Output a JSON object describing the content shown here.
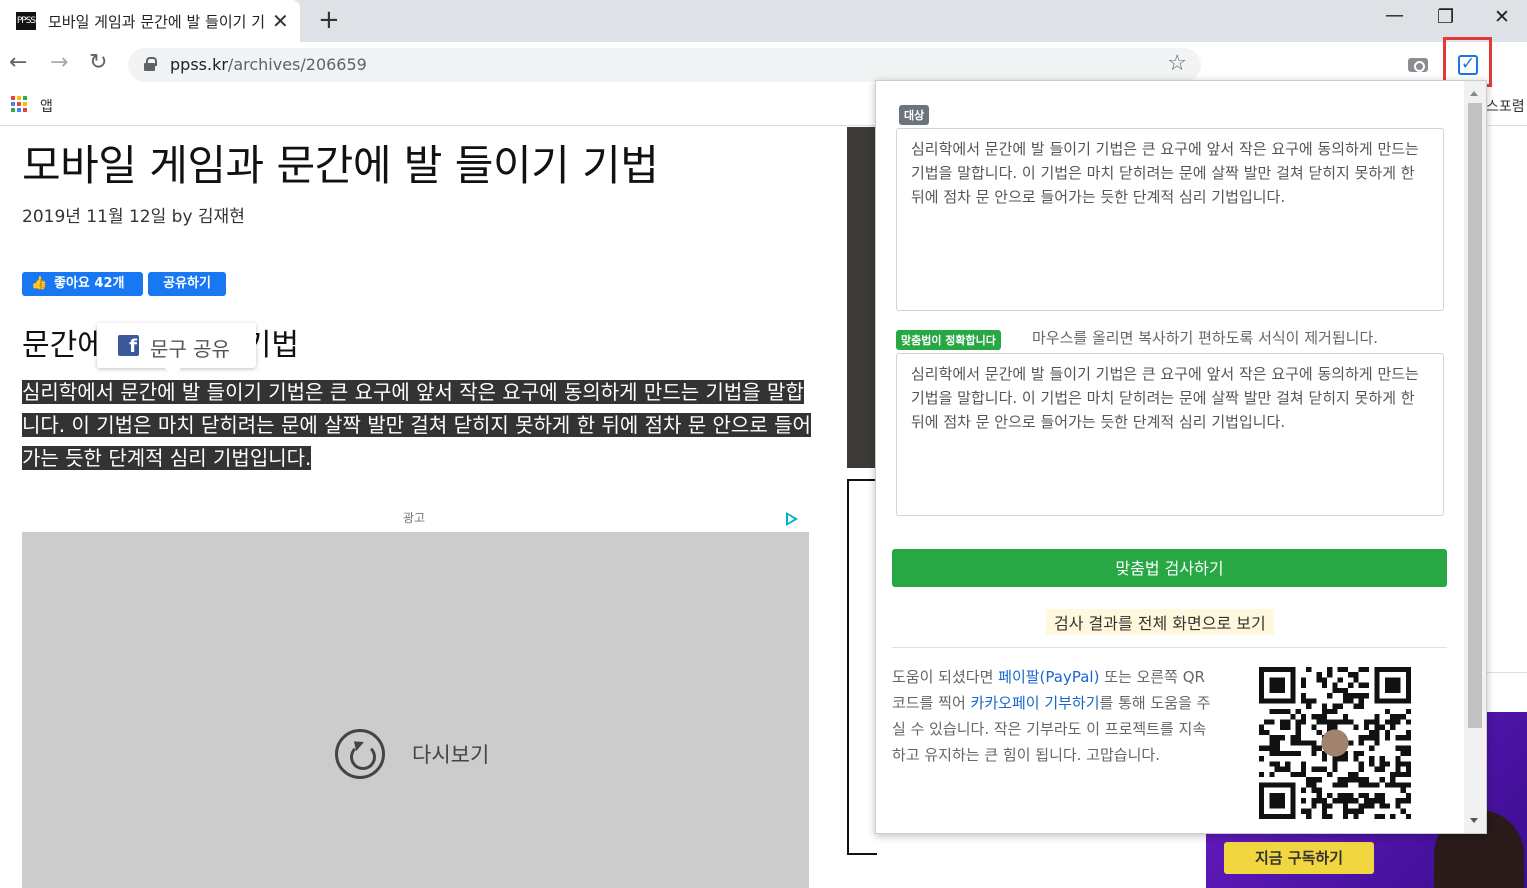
{
  "browser": {
    "tab_title": "모바일 게임과 문간에 발 들이기 기법",
    "tab_favicon": "PPSS",
    "url_host": "ppss.kr",
    "url_path": "/archives/206659",
    "bookmarks": {
      "apps_label": "앱",
      "right_item": "스포렴"
    },
    "icons": {
      "back": "back-arrow-icon",
      "forward": "forward-arrow-icon",
      "reload": "reload-icon",
      "star": "star-icon",
      "camera": "camera-icon",
      "extension": "check-square-icon"
    }
  },
  "article": {
    "title": "모바일 게임과 문간에 발 들이기 기법",
    "meta": "2019년 11월 12일 by 김재현",
    "like_button": "좋아요 42개",
    "share_button": "공유하기",
    "heading": "문간에 발 들이기 기법",
    "share_popover_label": "문구 공유",
    "body": "심리학에서 문간에 발 들이기 기법은 큰 요구에 앞서 작은 요구에 동의하게 만드는 기법을 말합니다. 이 기법은 마치 닫히려는 문에 살짝 발만 걸쳐 닫히지 못하게 한 뒤에 점차 문 안으로 들어가는 듯한 단계적 심리 기법입니다.",
    "ad_label": "광고",
    "replay_label": "다시보기"
  },
  "promo": {
    "button": "지금 구독하기"
  },
  "popup": {
    "target_badge": "대상",
    "target_text": "심리학에서 문간에 발 들이기 기법은 큰 요구에 앞서 작은 요구에 동의하게 만드는 기법을 말합니다. 이 기법은 마치 닫히려는 문에 살짝 발만 걸쳐 닫히지 못하게 한 뒤에 점차 문 안으로 들어가는 듯한 단계적 심리 기법입니다.",
    "result_badge": "맞춤법이 정확합니다",
    "result_hint": "마우스를 올리면 복사하기 편하도록 서식이 제거됩니다.",
    "result_text": "심리학에서 문간에 발 들이기 기법은 큰 요구에 앞서 작은 요구에 동의하게 만드는 기법을 말합니다. 이 기법은 마치 닫히려는 문에 살짝 발만 걸쳐 닫히지 못하게 한 뒤에 점차 문 안으로 들어가는 듯한 단계적 심리 기법입니다.",
    "check_button": "맞춤법 검사하기",
    "full_screen_link": "검사 결과를 전체 화면으로 보기",
    "donate": {
      "part1": "도움이 되셨다면 ",
      "paypal_link": "페이팔(PayPal)",
      "part2": " 또는 오른쪽 QR코드를 찍어 ",
      "kakao_link": "카카오페이 기부하기",
      "part3": "를 통해 도움을 주실 수 있습니다. 작은 기부라도 이 프로젝트를 지속하고 유지하는 큰 힘이 됩니다. 고맙습니다."
    }
  },
  "colors": {
    "green": "#28a745",
    "link_blue": "#1a66cc",
    "facebook_blue": "#1877f2",
    "highlight_red": "#e53935"
  }
}
